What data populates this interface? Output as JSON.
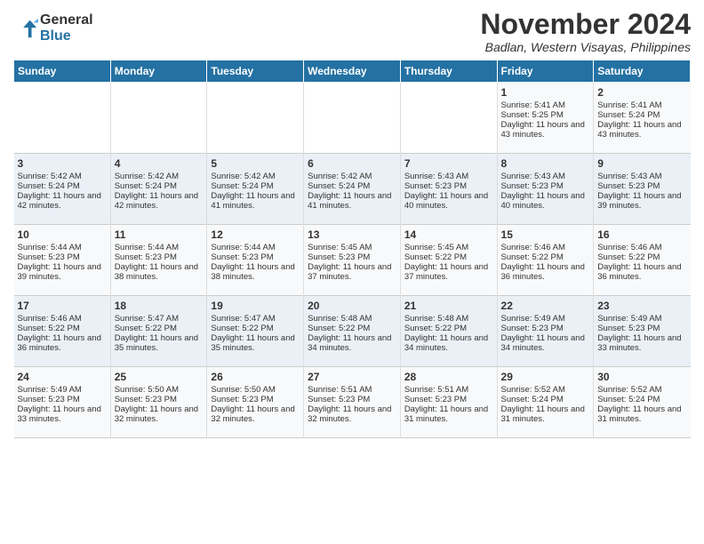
{
  "header": {
    "logo_line1": "General",
    "logo_line2": "Blue",
    "month_title": "November 2024",
    "location": "Badlan, Western Visayas, Philippines"
  },
  "days_of_week": [
    "Sunday",
    "Monday",
    "Tuesday",
    "Wednesday",
    "Thursday",
    "Friday",
    "Saturday"
  ],
  "weeks": [
    [
      {
        "day": "",
        "info": ""
      },
      {
        "day": "",
        "info": ""
      },
      {
        "day": "",
        "info": ""
      },
      {
        "day": "",
        "info": ""
      },
      {
        "day": "",
        "info": ""
      },
      {
        "day": "1",
        "info": "Sunrise: 5:41 AM\nSunset: 5:25 PM\nDaylight: 11 hours and 43 minutes."
      },
      {
        "day": "2",
        "info": "Sunrise: 5:41 AM\nSunset: 5:24 PM\nDaylight: 11 hours and 43 minutes."
      }
    ],
    [
      {
        "day": "3",
        "info": "Sunrise: 5:42 AM\nSunset: 5:24 PM\nDaylight: 11 hours and 42 minutes."
      },
      {
        "day": "4",
        "info": "Sunrise: 5:42 AM\nSunset: 5:24 PM\nDaylight: 11 hours and 42 minutes."
      },
      {
        "day": "5",
        "info": "Sunrise: 5:42 AM\nSunset: 5:24 PM\nDaylight: 11 hours and 41 minutes."
      },
      {
        "day": "6",
        "info": "Sunrise: 5:42 AM\nSunset: 5:24 PM\nDaylight: 11 hours and 41 minutes."
      },
      {
        "day": "7",
        "info": "Sunrise: 5:43 AM\nSunset: 5:23 PM\nDaylight: 11 hours and 40 minutes."
      },
      {
        "day": "8",
        "info": "Sunrise: 5:43 AM\nSunset: 5:23 PM\nDaylight: 11 hours and 40 minutes."
      },
      {
        "day": "9",
        "info": "Sunrise: 5:43 AM\nSunset: 5:23 PM\nDaylight: 11 hours and 39 minutes."
      }
    ],
    [
      {
        "day": "10",
        "info": "Sunrise: 5:44 AM\nSunset: 5:23 PM\nDaylight: 11 hours and 39 minutes."
      },
      {
        "day": "11",
        "info": "Sunrise: 5:44 AM\nSunset: 5:23 PM\nDaylight: 11 hours and 38 minutes."
      },
      {
        "day": "12",
        "info": "Sunrise: 5:44 AM\nSunset: 5:23 PM\nDaylight: 11 hours and 38 minutes."
      },
      {
        "day": "13",
        "info": "Sunrise: 5:45 AM\nSunset: 5:23 PM\nDaylight: 11 hours and 37 minutes."
      },
      {
        "day": "14",
        "info": "Sunrise: 5:45 AM\nSunset: 5:22 PM\nDaylight: 11 hours and 37 minutes."
      },
      {
        "day": "15",
        "info": "Sunrise: 5:46 AM\nSunset: 5:22 PM\nDaylight: 11 hours and 36 minutes."
      },
      {
        "day": "16",
        "info": "Sunrise: 5:46 AM\nSunset: 5:22 PM\nDaylight: 11 hours and 36 minutes."
      }
    ],
    [
      {
        "day": "17",
        "info": "Sunrise: 5:46 AM\nSunset: 5:22 PM\nDaylight: 11 hours and 36 minutes."
      },
      {
        "day": "18",
        "info": "Sunrise: 5:47 AM\nSunset: 5:22 PM\nDaylight: 11 hours and 35 minutes."
      },
      {
        "day": "19",
        "info": "Sunrise: 5:47 AM\nSunset: 5:22 PM\nDaylight: 11 hours and 35 minutes."
      },
      {
        "day": "20",
        "info": "Sunrise: 5:48 AM\nSunset: 5:22 PM\nDaylight: 11 hours and 34 minutes."
      },
      {
        "day": "21",
        "info": "Sunrise: 5:48 AM\nSunset: 5:22 PM\nDaylight: 11 hours and 34 minutes."
      },
      {
        "day": "22",
        "info": "Sunrise: 5:49 AM\nSunset: 5:23 PM\nDaylight: 11 hours and 34 minutes."
      },
      {
        "day": "23",
        "info": "Sunrise: 5:49 AM\nSunset: 5:23 PM\nDaylight: 11 hours and 33 minutes."
      }
    ],
    [
      {
        "day": "24",
        "info": "Sunrise: 5:49 AM\nSunset: 5:23 PM\nDaylight: 11 hours and 33 minutes."
      },
      {
        "day": "25",
        "info": "Sunrise: 5:50 AM\nSunset: 5:23 PM\nDaylight: 11 hours and 32 minutes."
      },
      {
        "day": "26",
        "info": "Sunrise: 5:50 AM\nSunset: 5:23 PM\nDaylight: 11 hours and 32 minutes."
      },
      {
        "day": "27",
        "info": "Sunrise: 5:51 AM\nSunset: 5:23 PM\nDaylight: 11 hours and 32 minutes."
      },
      {
        "day": "28",
        "info": "Sunrise: 5:51 AM\nSunset: 5:23 PM\nDaylight: 11 hours and 31 minutes."
      },
      {
        "day": "29",
        "info": "Sunrise: 5:52 AM\nSunset: 5:24 PM\nDaylight: 11 hours and 31 minutes."
      },
      {
        "day": "30",
        "info": "Sunrise: 5:52 AM\nSunset: 5:24 PM\nDaylight: 11 hours and 31 minutes."
      }
    ]
  ]
}
